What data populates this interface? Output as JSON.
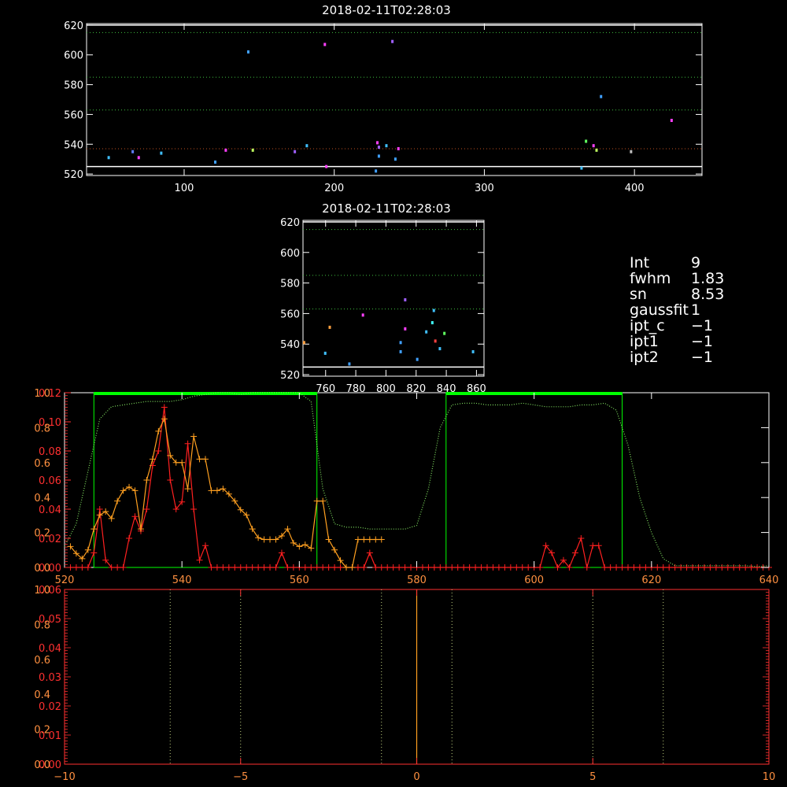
{
  "info_panel": {
    "items": [
      {
        "key": "Int",
        "value": "9"
      },
      {
        "key": "fwhm",
        "value": "1.83"
      },
      {
        "key": "sn",
        "value": "8.53"
      },
      {
        "key": "gaussfit",
        "value": "1"
      },
      {
        "key": "ipt_c",
        "value": "−1"
      },
      {
        "key": "ipt1",
        "value": "−1"
      },
      {
        "key": "ipt2",
        "value": "−1"
      }
    ]
  },
  "colors": {
    "background": "#000000",
    "axis": "#ffffff",
    "red_axis": "#ff3030",
    "orange": "#ffa020",
    "green": "#00ff00",
    "dotted_green": "#80e060",
    "red_line": "#ff2020"
  },
  "chart_data": [
    {
      "type": "scatter",
      "title": "2018-02-11T02:28:03",
      "xlim": [
        35,
        445
      ],
      "ylim": [
        519,
        621
      ],
      "xticks": [
        100,
        200,
        300,
        400
      ],
      "yticks": [
        520,
        540,
        560,
        580,
        600,
        620
      ],
      "hlines": [
        {
          "y": 615,
          "color": "#40c040",
          "style": "dotted"
        },
        {
          "y": 585,
          "color": "#40c040",
          "style": "dotted"
        },
        {
          "y": 563,
          "color": "#40c040",
          "style": "dotted"
        },
        {
          "y": 537,
          "color": "#c05020",
          "style": "dotted"
        },
        {
          "y": 525,
          "color": "#ffffff",
          "style": "solid"
        },
        {
          "y": 620,
          "color": "#ffffff",
          "style": "solid"
        }
      ],
      "points": [
        {
          "x": 50,
          "y": 531,
          "color": "#40c0ff"
        },
        {
          "x": 66,
          "y": 535,
          "color": "#6080ff"
        },
        {
          "x": 70,
          "y": 531,
          "color": "#ff40ff"
        },
        {
          "x": 85,
          "y": 534,
          "color": "#40c0ff"
        },
        {
          "x": 121,
          "y": 528,
          "color": "#40a0ff"
        },
        {
          "x": 128,
          "y": 536,
          "color": "#ff40ff"
        },
        {
          "x": 143,
          "y": 602,
          "color": "#40a0ff"
        },
        {
          "x": 146,
          "y": 536,
          "color": "#c0ff60"
        },
        {
          "x": 174,
          "y": 535,
          "color": "#a060ff"
        },
        {
          "x": 182,
          "y": 539,
          "color": "#40c0ff"
        },
        {
          "x": 194,
          "y": 607,
          "color": "#ff40ff"
        },
        {
          "x": 195,
          "y": 525,
          "color": "#ff40ff"
        },
        {
          "x": 228,
          "y": 522,
          "color": "#40a0ff"
        },
        {
          "x": 229,
          "y": 541,
          "color": "#ff40ff"
        },
        {
          "x": 230,
          "y": 538,
          "color": "#a060ff"
        },
        {
          "x": 230,
          "y": 532,
          "color": "#40a0ff"
        },
        {
          "x": 235,
          "y": 539,
          "color": "#40c0ff"
        },
        {
          "x": 239,
          "y": 609,
          "color": "#a060ff"
        },
        {
          "x": 241,
          "y": 530,
          "color": "#40a0ff"
        },
        {
          "x": 243,
          "y": 537,
          "color": "#ff40ff"
        },
        {
          "x": 365,
          "y": 524,
          "color": "#40c0ff"
        },
        {
          "x": 368,
          "y": 542,
          "color": "#60ff60"
        },
        {
          "x": 373,
          "y": 539,
          "color": "#ff40ff"
        },
        {
          "x": 375,
          "y": 536,
          "color": "#c0ff60"
        },
        {
          "x": 378,
          "y": 572,
          "color": "#40a0ff"
        },
        {
          "x": 398,
          "y": 535,
          "color": "#c0c0c0"
        },
        {
          "x": 425,
          "y": 556,
          "color": "#ff40ff"
        }
      ]
    },
    {
      "type": "scatter",
      "title": "2018-02-11T02:28:03",
      "xlim": [
        745,
        865
      ],
      "ylim": [
        519,
        621
      ],
      "xticks": [
        760,
        780,
        800,
        820,
        840,
        860
      ],
      "yticks": [
        520,
        540,
        560,
        580,
        600,
        620
      ],
      "hlines": [
        {
          "y": 615,
          "color": "#40c040",
          "style": "dotted"
        },
        {
          "y": 585,
          "color": "#40c040",
          "style": "dotted"
        },
        {
          "y": 563,
          "color": "#40c040",
          "style": "dotted"
        },
        {
          "y": 525,
          "color": "#ffffff",
          "style": "solid"
        },
        {
          "y": 620,
          "color": "#ffffff",
          "style": "solid"
        }
      ],
      "points": [
        {
          "x": 746,
          "y": 541,
          "color": "#ffa040"
        },
        {
          "x": 760,
          "y": 534,
          "color": "#40c0ff"
        },
        {
          "x": 763,
          "y": 551,
          "color": "#ffa040"
        },
        {
          "x": 776,
          "y": 527,
          "color": "#40a0ff"
        },
        {
          "x": 785,
          "y": 559,
          "color": "#ff40ff"
        },
        {
          "x": 810,
          "y": 541,
          "color": "#40a0ff"
        },
        {
          "x": 810,
          "y": 535,
          "color": "#40a0ff"
        },
        {
          "x": 813,
          "y": 569,
          "color": "#a060ff"
        },
        {
          "x": 813,
          "y": 550,
          "color": "#ff40ff"
        },
        {
          "x": 821,
          "y": 530,
          "color": "#40a0ff"
        },
        {
          "x": 827,
          "y": 548,
          "color": "#40c0ff"
        },
        {
          "x": 831,
          "y": 554,
          "color": "#40ffff"
        },
        {
          "x": 832,
          "y": 562,
          "color": "#40c0ff"
        },
        {
          "x": 833,
          "y": 542,
          "color": "#ff4040"
        },
        {
          "x": 836,
          "y": 537,
          "color": "#40c0ff"
        },
        {
          "x": 839,
          "y": 547,
          "color": "#60ff60"
        },
        {
          "x": 858,
          "y": 535,
          "color": "#40c0ff"
        }
      ]
    },
    {
      "type": "line",
      "xlim": [
        520,
        640
      ],
      "xticks": [
        520,
        540,
        560,
        580,
        600,
        620,
        640
      ],
      "y_red_ticks": [
        "0.00",
        "0.02",
        "0.04",
        "0.06",
        "0.08",
        "0.10",
        "0.12"
      ],
      "y_orange_ticks": [
        "0.0",
        "0.2",
        "0.4",
        "0.6",
        "0.8",
        "1.0"
      ],
      "ylim_red": [
        0,
        0.12
      ],
      "ylim_orange": [
        0,
        1.0
      ],
      "green_boxes": [
        [
          525,
          563
        ],
        [
          585,
          615
        ]
      ],
      "series": [
        {
          "color": "#ff2020",
          "axis": "red",
          "x": [
            521,
            522,
            523,
            524,
            525,
            526,
            527,
            528,
            529,
            530,
            531,
            532,
            533,
            534,
            535,
            536,
            537,
            538,
            539,
            540,
            541,
            542,
            543,
            544,
            545,
            546,
            547,
            548,
            549,
            550,
            551,
            552,
            553,
            554,
            555,
            556,
            557,
            558,
            559,
            560,
            561,
            562,
            563,
            564,
            565,
            566,
            567,
            568,
            569,
            570,
            571,
            572,
            573,
            574,
            575,
            576,
            577,
            578,
            579,
            580,
            581,
            582,
            583,
            584,
            585,
            586,
            587,
            588,
            589,
            590,
            591,
            592,
            593,
            594,
            595,
            596,
            597,
            598,
            599,
            600,
            601,
            602,
            603,
            604,
            605,
            606,
            607,
            608,
            609,
            610,
            611,
            612,
            613,
            614,
            615,
            616,
            617,
            618,
            619,
            620,
            621,
            622,
            623,
            624,
            625,
            626,
            627,
            628,
            629,
            630,
            631,
            632,
            633,
            634,
            635,
            636,
            637,
            638,
            639,
            640
          ],
          "y": [
            0,
            0,
            0,
            0,
            0.01,
            0.04,
            0.005,
            0,
            0,
            0,
            0.02,
            0.035,
            0.025,
            0.04,
            0.07,
            0.08,
            0.11,
            0.06,
            0.04,
            0.045,
            0.085,
            0.04,
            0.005,
            0.015,
            0,
            0,
            0,
            0,
            0,
            0,
            0,
            0,
            0,
            0,
            0,
            0,
            0.01,
            0,
            0,
            0,
            0,
            0,
            0,
            0,
            0,
            0,
            0,
            0,
            0,
            0,
            0,
            0.01,
            0,
            0,
            0,
            0,
            0,
            0,
            0,
            0,
            0,
            0,
            0,
            0,
            0,
            0,
            0,
            0,
            0,
            0,
            0,
            0,
            0,
            0,
            0,
            0,
            0,
            0,
            0,
            0,
            0,
            0.015,
            0.01,
            0,
            0.005,
            0,
            0.01,
            0.02,
            0,
            0.015,
            0.015,
            0,
            0,
            0,
            0,
            0,
            0,
            0,
            0,
            0,
            0,
            0,
            0,
            0,
            0,
            0,
            0,
            0,
            0,
            0,
            0,
            0,
            0,
            0,
            0,
            0,
            0,
            0,
            0,
            0
          ]
        },
        {
          "color": "#ffa020",
          "axis": "orange",
          "x": [
            521,
            522,
            523,
            524,
            525,
            526,
            527,
            528,
            529,
            530,
            531,
            532,
            533,
            534,
            535,
            536,
            537,
            538,
            539,
            540,
            541,
            542,
            543,
            544,
            545,
            546,
            547,
            548,
            549,
            550,
            551,
            552,
            553,
            554,
            555,
            556,
            557,
            558,
            559,
            560,
            561,
            562,
            563,
            564,
            565,
            566,
            567,
            568,
            569,
            570,
            571,
            572,
            573,
            574
          ],
          "y": [
            0.12,
            0.08,
            0.05,
            0.1,
            0.22,
            0.3,
            0.32,
            0.28,
            0.38,
            0.44,
            0.46,
            0.44,
            0.22,
            0.5,
            0.62,
            0.78,
            0.85,
            0.64,
            0.6,
            0.6,
            0.45,
            0.75,
            0.62,
            0.62,
            0.44,
            0.44,
            0.45,
            0.42,
            0.38,
            0.33,
            0.3,
            0.22,
            0.17,
            0.16,
            0.16,
            0.16,
            0.18,
            0.22,
            0.14,
            0.12,
            0.13,
            0.11,
            0.38,
            0.38,
            0.16,
            0.1,
            0.04,
            0,
            0,
            0.16,
            0.16,
            0.16,
            0.16,
            0.16
          ]
        },
        {
          "color": "#80e060",
          "axis": "orange",
          "style": "dotted",
          "x": [
            520,
            522,
            524,
            526,
            528,
            530,
            532,
            534,
            536,
            538,
            540,
            542,
            544,
            546,
            548,
            550,
            552,
            554,
            556,
            558,
            560,
            562,
            564,
            566,
            568,
            570,
            572,
            574,
            576,
            578,
            580,
            582,
            584,
            586,
            588,
            590,
            592,
            594,
            596,
            598,
            600,
            602,
            604,
            606,
            608,
            610,
            612,
            614,
            616,
            618,
            620,
            622,
            624,
            626,
            628,
            630,
            632,
            634,
            636,
            638,
            640
          ],
          "y": [
            0.12,
            0.25,
            0.55,
            0.85,
            0.92,
            0.93,
            0.94,
            0.95,
            0.95,
            0.95,
            0.96,
            0.98,
            0.99,
            1.0,
            1.0,
            0.99,
            1.0,
            1.0,
            1.0,
            1.0,
            1.0,
            0.95,
            0.45,
            0.25,
            0.23,
            0.23,
            0.22,
            0.22,
            0.22,
            0.22,
            0.24,
            0.45,
            0.8,
            0.93,
            0.94,
            0.94,
            0.93,
            0.93,
            0.93,
            0.94,
            0.93,
            0.92,
            0.92,
            0.92,
            0.93,
            0.93,
            0.94,
            0.9,
            0.7,
            0.4,
            0.2,
            0.05,
            0.01,
            0.01,
            0.01,
            0.01,
            0.01,
            0.01,
            0.01,
            0.005,
            0.01
          ]
        }
      ]
    },
    {
      "type": "line",
      "xlim": [
        -10,
        10
      ],
      "xticks": [
        "−10",
        "−5",
        "0",
        "5",
        "10"
      ],
      "y_red_ticks": [
        "0.00",
        "0.01",
        "0.02",
        "0.03",
        "0.04",
        "0.05",
        "0.06"
      ],
      "y_orange_ticks": [
        "0.0",
        "0.2",
        "0.4",
        "0.6",
        "0.8",
        "1.0"
      ],
      "vlines": [
        {
          "x": -7,
          "color": "#c0d080",
          "style": "dotted"
        },
        {
          "x": -5,
          "color": "#c0d080",
          "style": "dotted"
        },
        {
          "x": -1,
          "color": "#c0d080",
          "style": "dotted"
        },
        {
          "x": 1,
          "color": "#c0d080",
          "style": "dotted"
        },
        {
          "x": 5,
          "color": "#c0d080",
          "style": "dotted"
        },
        {
          "x": 7,
          "color": "#c0d080",
          "style": "dotted"
        },
        {
          "x": 0,
          "color": "#ffa020",
          "style": "solid"
        }
      ]
    }
  ]
}
